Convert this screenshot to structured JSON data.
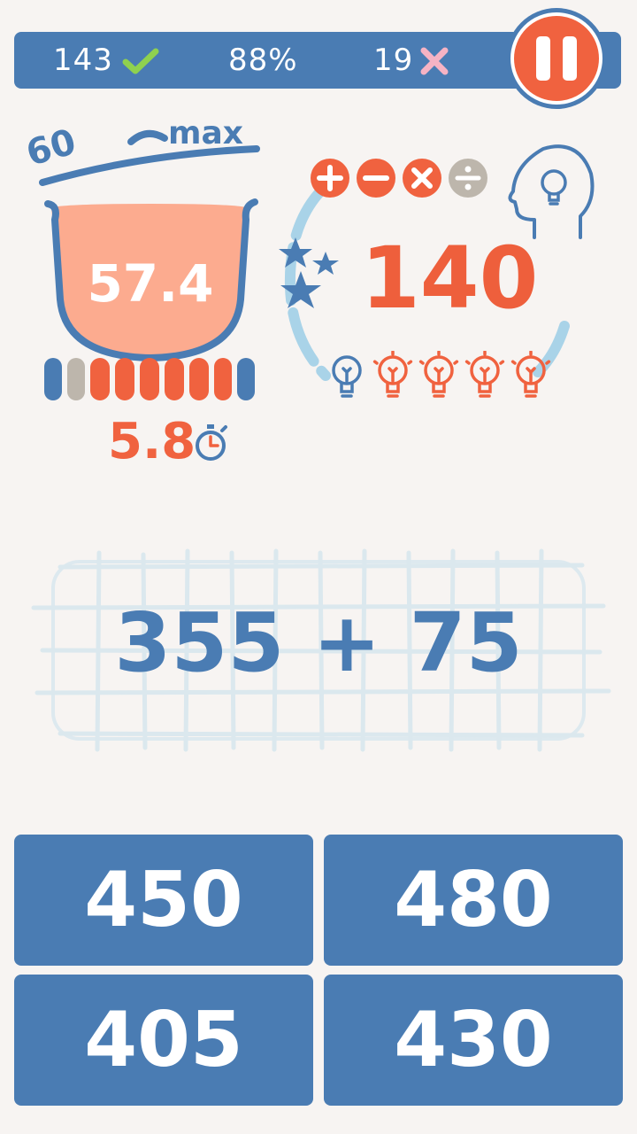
{
  "status_bar": {
    "correct_count": "143",
    "accuracy": "88%",
    "wrong_count": "19"
  },
  "pot": {
    "min_label": "60",
    "max_label": "max",
    "value": "57.4",
    "burner_segments": [
      "blue",
      "gray",
      "red",
      "red",
      "red",
      "red",
      "red",
      "red",
      "red",
      "blue"
    ]
  },
  "timer": {
    "value": "5.8"
  },
  "operations": [
    "plus",
    "minus",
    "times",
    "divide"
  ],
  "score": "140",
  "hint_bulbs": [
    "used",
    "available",
    "available",
    "available",
    "available"
  ],
  "problem": {
    "expression": "355 + 75"
  },
  "answers": [
    "450",
    "480",
    "405",
    "430"
  ],
  "colors": {
    "blue": "#4a7cb3",
    "red": "#f0623f",
    "light_blue": "#a9d3e8",
    "pot_fill": "#fcab8f",
    "background": "#f7f4f2"
  }
}
